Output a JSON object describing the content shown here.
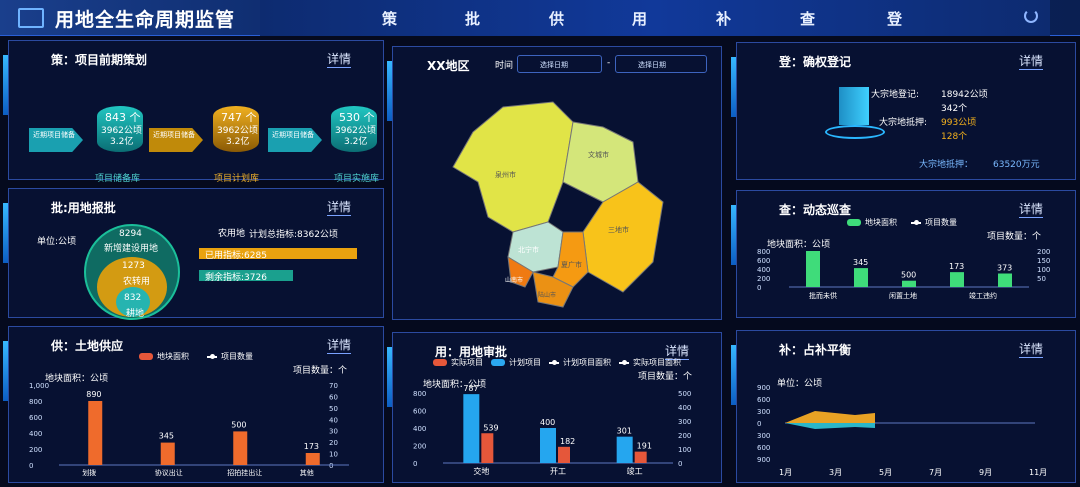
{
  "header": {
    "title": "用地全生命周期监管",
    "nav": [
      "策",
      "批",
      "供",
      "用",
      "补",
      "查",
      "登"
    ]
  },
  "panels": {
    "ce": {
      "title": "策：项目前期策划",
      "detail": "详情",
      "items": [
        {
          "count": "843 个",
          "area": "3962公顷",
          "money": "3.2亿",
          "arrow": "近期项目储备",
          "label": "项目储备库"
        },
        {
          "count": "747 个",
          "area": "3962公顷",
          "money": "3.2亿",
          "arrow": "近期项目储备",
          "label": "项目计划库"
        },
        {
          "count": "530 个",
          "area": "3962公顷",
          "money": "3.2亿",
          "arrow": "近期项目储备",
          "label": "项目实施库"
        }
      ]
    },
    "pi": {
      "title": "批:用地报批",
      "detail": "详情",
      "unit": "单位:公顷",
      "outer": "8294",
      "outer_label": "新增建设用地",
      "mid": "1273",
      "mid_label": "农转用",
      "inner": "832",
      "inner_label": "耕地",
      "farm": "农用地",
      "plan": "计划总指标:8362公顷",
      "used": "已用指标:6285",
      "left": "剩余指标:3726"
    },
    "gong": {
      "title": "供：土地供应",
      "detail": "详情",
      "legend1": "地块面积",
      "legend2": "项目数量",
      "yl": "地块面积：公顷",
      "yr": "项目数量：个"
    },
    "map": {
      "title": "XX地区",
      "time": "时间",
      "start": "选择日期",
      "end": "选择日期",
      "dash": "-",
      "cities": [
        "泉州市",
        "文城市",
        "三地市",
        "北宁市",
        "夏广市",
        "山南市",
        "陆山市"
      ]
    },
    "yong": {
      "title": "用：用地审批",
      "detail": "详情",
      "legend": [
        "实际项目",
        "计划项目",
        "计划项目面积",
        "实际项目面积"
      ],
      "yl": "地块面积：公顷",
      "yr": "项目数量：个"
    },
    "deng": {
      "title": "登：确权登记",
      "detail": "详情",
      "l1": "大宗地登记:",
      "v1": "18942公顷",
      "v1b": "342个",
      "l2": "大宗地抵押:",
      "v2": "993公顷",
      "v2b": "128个",
      "bottom_label": "大宗地抵押：",
      "bottom_value": "63520万元"
    },
    "cha": {
      "title": "查：动态巡查",
      "detail": "详情",
      "legend1": "地块面积",
      "legend2": "项目数量",
      "yl": "地块面积：公顷",
      "yr": "项目数量：个"
    },
    "bu": {
      "title": "补：占补平衡",
      "detail": "详情",
      "unit": "单位：公顷"
    }
  },
  "chart_data": [
    {
      "type": "bar",
      "categories": [
        "划拨",
        "协议出让",
        "招拍挂出让",
        "其他"
      ],
      "series": [
        {
          "name": "地块面积",
          "values": [
            800,
            280,
            420,
            150
          ]
        },
        {
          "name": "项目数量",
          "values": [
            890,
            345,
            500,
            173
          ]
        }
      ],
      "ylim": [
        0,
        1000
      ],
      "y2lim": [
        0,
        70
      ]
    },
    {
      "type": "bar",
      "categories": [
        "交地",
        "开工",
        "竣工"
      ],
      "series": [
        {
          "name": "实际项目",
          "values": [
            680,
            370,
            260
          ]
        },
        {
          "name": "计划项目",
          "values": [
            787,
            400,
            301
          ]
        }
      ],
      "labels1": [
        787,
        400,
        301
      ],
      "labels2": [
        539,
        182,
        191
      ],
      "ylim": [
        0,
        800
      ],
      "y2lim": [
        0,
        500
      ]
    },
    {
      "type": "bar",
      "categories": [
        "批而未供",
        "闲置土地",
        "竣工违约"
      ],
      "series": [
        {
          "name": "地块面积",
          "values": [
            800,
            420,
            140,
            330
          ]
        },
        {
          "name": "项目数量",
          "values": [
            890,
            345,
            500,
            173,
            373
          ]
        }
      ],
      "ylim": [
        0,
        800
      ],
      "y2lim": [
        0,
        200
      ]
    },
    {
      "type": "area",
      "x": [
        "1月",
        "3月",
        "5月",
        "7月",
        "9月",
        "11月"
      ],
      "ylim": [
        -900,
        900
      ]
    }
  ]
}
